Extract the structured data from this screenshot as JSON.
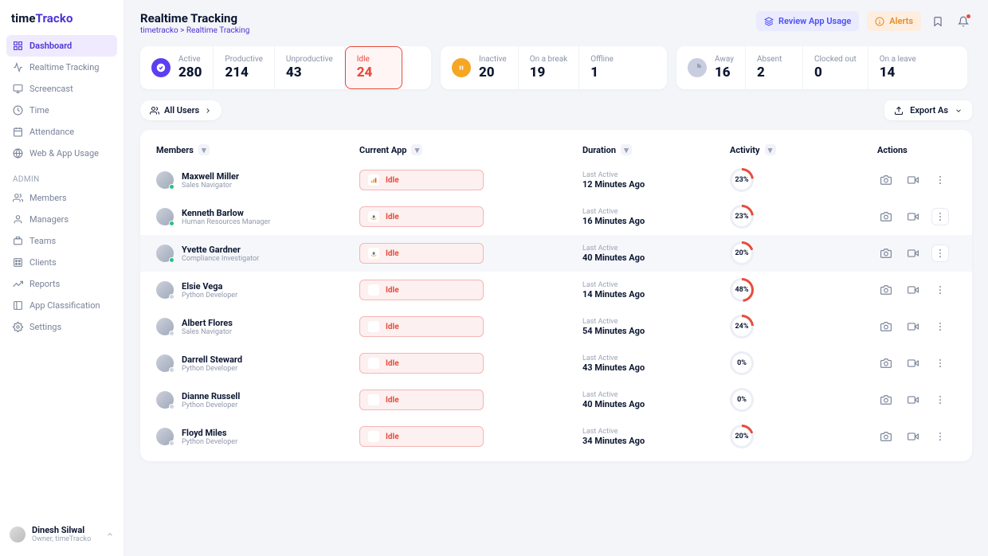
{
  "brand": {
    "time": "time",
    "tracko": "Tracko"
  },
  "sidebar": {
    "main": [
      {
        "label": "Dashboard"
      },
      {
        "label": "Realtime Tracking"
      },
      {
        "label": "Screencast"
      },
      {
        "label": "Time"
      },
      {
        "label": "Attendance"
      },
      {
        "label": "Web & App Usage"
      }
    ],
    "admin_label": "ADMIN",
    "admin": [
      {
        "label": "Members"
      },
      {
        "label": "Managers"
      },
      {
        "label": "Teams"
      },
      {
        "label": "Clients"
      },
      {
        "label": "Reports"
      },
      {
        "label": "App Classification"
      },
      {
        "label": "Settings"
      }
    ]
  },
  "user": {
    "name": "Dinesh Silwal",
    "role": "Owner, timeTracko"
  },
  "page": {
    "title": "Realtime Tracking",
    "breadcrumb": "timetracko > Realtime Tracking"
  },
  "top_buttons": {
    "review": "Review App Usage",
    "alerts": "Alerts"
  },
  "stats": {
    "active": {
      "label": "Active",
      "value": "280"
    },
    "productive": {
      "label": "Productive",
      "value": "214"
    },
    "unproductive": {
      "label": "Unproductive",
      "value": "43"
    },
    "idle": {
      "label": "Idle",
      "value": "24"
    },
    "inactive": {
      "label": "Inactive",
      "value": "20"
    },
    "on_a_break": {
      "label": "On a break",
      "value": "19"
    },
    "offline": {
      "label": "Offline",
      "value": "1"
    },
    "away": {
      "label": "Away",
      "value": "16"
    },
    "absent": {
      "label": "Absent",
      "value": "2"
    },
    "clocked_out": {
      "label": "Clocked out",
      "value": "0"
    },
    "on_a_leave": {
      "label": "On a leave",
      "value": "14"
    }
  },
  "filters": {
    "all_users": "All Users",
    "export": "Export As"
  },
  "columns": {
    "members": "Members",
    "current_app": "Current App",
    "duration": "Duration",
    "activity": "Activity",
    "actions": "Actions"
  },
  "rows": [
    {
      "name": "Maxwell Miller",
      "role": "Sales Navigator",
      "app": "Idle",
      "appicon": "analytics",
      "last_label": "Last Active",
      "last_value": "12 Minutes Ago",
      "activity": "23%",
      "pct": 23,
      "presence": "green",
      "hover": false,
      "boxed": false,
      "ring": true
    },
    {
      "name": "Kenneth Barlow",
      "role": "Human Resources Manager",
      "app": "Idle",
      "appicon": "amazon",
      "last_label": "Last Active",
      "last_value": "16 Minutes Ago",
      "activity": "23%",
      "pct": 23,
      "presence": "green",
      "hover": false,
      "boxed": true,
      "ring": true
    },
    {
      "name": "Yvette Gardner",
      "role": "Compliance Investigator",
      "app": "Idle",
      "appicon": "amazon",
      "last_label": "Last Active",
      "last_value": "40 Minutes Ago",
      "activity": "20%",
      "pct": 20,
      "presence": "green",
      "hover": true,
      "boxed": true,
      "ring": true
    },
    {
      "name": "Elsie Vega",
      "role": "Python Developer",
      "app": "Idle",
      "appicon": "none",
      "last_label": "Last Active",
      "last_value": "14 Minutes Ago",
      "activity": "48%",
      "pct": 48,
      "presence": "gray",
      "hover": false,
      "boxed": false,
      "ring": true
    },
    {
      "name": "Albert Flores",
      "role": "Sales Navigator",
      "app": "Idle",
      "appicon": "none",
      "last_label": "Last Active",
      "last_value": "54 Minutes Ago",
      "activity": "24%",
      "pct": 24,
      "presence": "gray",
      "hover": false,
      "boxed": false,
      "ring": true
    },
    {
      "name": "Darrell Steward",
      "role": "Python Developer",
      "app": "Idle",
      "appicon": "none",
      "last_label": "Last Active",
      "last_value": "43 Minutes Ago",
      "activity": "0%",
      "pct": 0,
      "presence": "gray",
      "hover": false,
      "boxed": false,
      "ring": false
    },
    {
      "name": "Dianne Russell",
      "role": "Python Developer",
      "app": "Idle",
      "appicon": "none",
      "last_label": "Last Active",
      "last_value": "40 Minutes Ago",
      "activity": "0%",
      "pct": 0,
      "presence": "gray",
      "hover": false,
      "boxed": false,
      "ring": false
    },
    {
      "name": "Floyd Miles",
      "role": "Python Developer",
      "app": "Idle",
      "appicon": "none",
      "last_label": "Last Active",
      "last_value": "34 Minutes Ago",
      "activity": "20%",
      "pct": 20,
      "presence": "gray",
      "hover": false,
      "boxed": false,
      "ring": true
    }
  ]
}
